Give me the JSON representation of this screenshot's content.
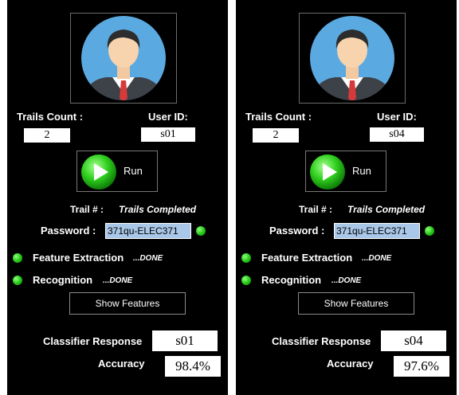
{
  "colors": {
    "panel_bg": "#000000",
    "accent_green": "#22c414",
    "password_bg": "#a9c7e8"
  },
  "panels": [
    {
      "avatar_icon": "user-avatar-icon",
      "trails_count_label": "Trails Count :",
      "trails_count_value": "2",
      "user_id_label": "User ID:",
      "user_id_value": "s01",
      "run_label": "Run",
      "trail_label": "Trail # :",
      "trail_status": "Trails Completed",
      "password_label": "Password :",
      "password_value": "371qu-ELEC371",
      "feature_extraction_label": "Feature Extraction",
      "feature_extraction_status": "...DONE",
      "recognition_label": "Recognition",
      "recognition_status": "...DONE",
      "show_features_label": "Show Features",
      "classifier_label": "Classifier Response",
      "classifier_value": "s01",
      "accuracy_label": "Accuracy",
      "accuracy_value": "98.4%"
    },
    {
      "avatar_icon": "user-avatar-icon",
      "trails_count_label": "Trails Count :",
      "trails_count_value": "2",
      "user_id_label": "User ID:",
      "user_id_value": "s04",
      "run_label": "Run",
      "trail_label": "Trail # :",
      "trail_status": "Trails Completed",
      "password_label": "Password :",
      "password_value": "371qu-ELEC371",
      "feature_extraction_label": "Feature Extraction",
      "feature_extraction_status": "...DONE",
      "recognition_label": "Recognition",
      "recognition_status": "...DONE",
      "show_features_label": "Show Features",
      "classifier_label": "Classifier Response",
      "classifier_value": "s04",
      "accuracy_label": "Accuracy",
      "accuracy_value": "97.6%"
    }
  ]
}
